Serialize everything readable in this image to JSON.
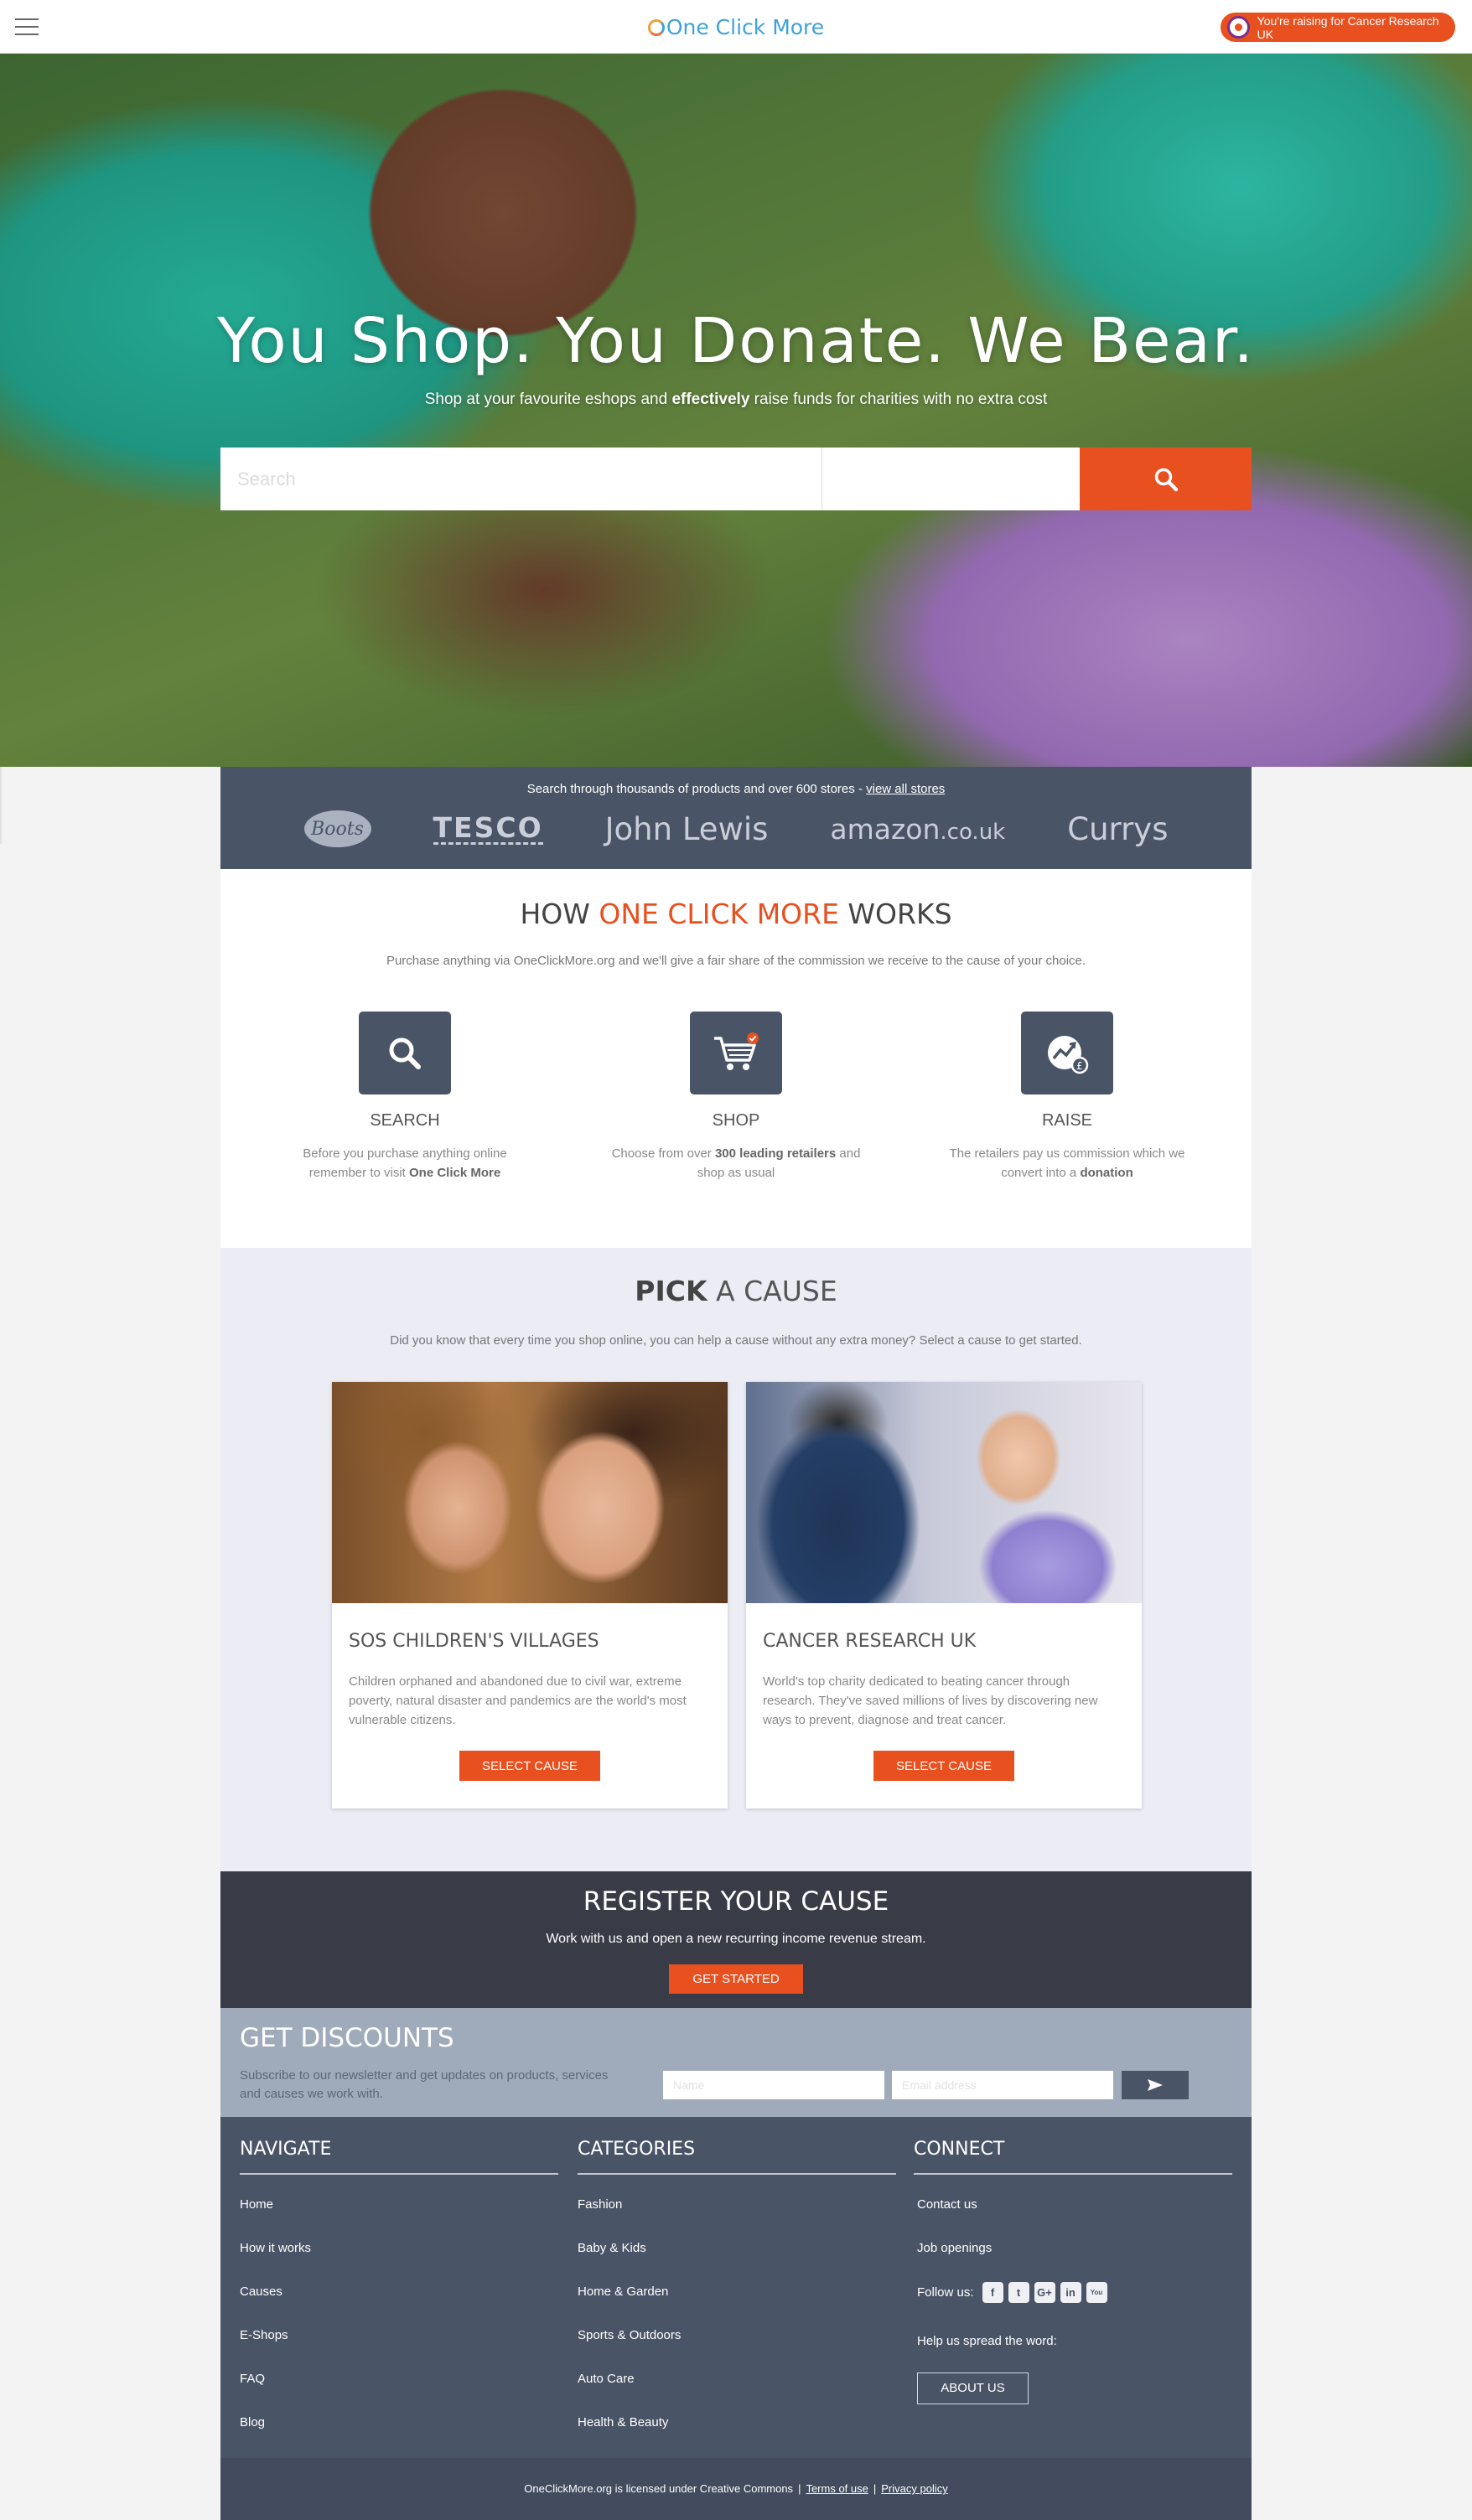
{
  "header": {
    "logo_text": "One Click More",
    "raising_label": "You're raising for Cancer Research UK"
  },
  "hero": {
    "title": "You Shop. You Donate. We Bear.",
    "subtitle_pre": "Shop at your favourite eshops and ",
    "subtitle_bold": "effectively",
    "subtitle_post": " raise funds for charities with no extra cost",
    "search_placeholder": "Search"
  },
  "stores": {
    "text": "Search through thousands of products and over 600 stores - ",
    "link": "view all stores",
    "logos": [
      "Boots",
      "TESCO",
      "John Lewis",
      "amazon",
      ".co.uk",
      "Currys"
    ]
  },
  "how": {
    "title_pre": "HOW ",
    "title_accent": "ONE CLICK MORE",
    "title_post": " WORKS",
    "intro": "Purchase anything via OneClickMore.org and we'll give a fair share of the commission we receive to the cause of your choice.",
    "steps": [
      {
        "title": "SEARCH",
        "desc_pre": "Before you purchase anything online remember to visit ",
        "desc_bold": "One Click More",
        "desc_post": ""
      },
      {
        "title": "SHOP",
        "desc_pre": "Choose from over ",
        "desc_bold": "300 leading retailers",
        "desc_post": " and shop as usual"
      },
      {
        "title": "RAISE",
        "desc_pre": "The retailers pay us commission which we convert into a ",
        "desc_bold": "donation",
        "desc_post": ""
      }
    ]
  },
  "cause": {
    "title_bold": "PICK",
    "title_rest": " A CAUSE",
    "intro": "Did you know that every time you shop online, you can help a cause without any extra money? Select a cause to get started.",
    "cards": [
      {
        "title": "SOS CHILDREN'S VILLAGES",
        "text": "Children orphaned and abandoned due to civil war, extreme poverty, natural disaster and pandemics are the world's most vulnerable citizens.",
        "button": "SELECT CAUSE"
      },
      {
        "title": "CANCER RESEARCH UK",
        "text": "World's top charity dedicated to beating cancer through research. They've saved millions of lives by discovering new ways to prevent, diagnose and treat cancer.",
        "button": "SELECT CAUSE"
      }
    ]
  },
  "register": {
    "title": "REGISTER YOUR CAUSE",
    "text": "Work with us and open a new recurring income revenue stream.",
    "button": "GET STARTED"
  },
  "discounts": {
    "title": "GET DISCOUNTS",
    "text": "Subscribe to our newsletter and get updates on products, services and causes we work with.",
    "name_placeholder": "Name",
    "email_placeholder": "Email address"
  },
  "footer": {
    "navigate": {
      "title": "NAVIGATE",
      "items": [
        "Home",
        "How it works",
        "Causes",
        "E-Shops",
        "FAQ",
        "Blog"
      ]
    },
    "categories": {
      "title": "CATEGORIES",
      "items": [
        "Fashion",
        "Baby & Kids",
        "Home & Garden",
        "Sports & Outdoors",
        "Auto Care",
        "Health & Beauty"
      ]
    },
    "connect": {
      "title": "CONNECT",
      "items": [
        "Contact us",
        "Job openings"
      ],
      "follow_label": "Follow us:",
      "social": [
        "f",
        "t",
        "G+",
        "in",
        "You"
      ],
      "spread_label": "Help us spread the word:",
      "about_button": "ABOUT US"
    }
  },
  "bottom": {
    "license": "OneClickMore.org is licensed under Creative Commons",
    "terms": "Terms of use",
    "privacy": "Privacy policy",
    "separator": "|"
  },
  "colors": {
    "accent": "#e8501f",
    "slate": "#4a5467",
    "dark": "#393b47",
    "discount_bg": "#9fabbb",
    "cause_bg": "#ebecf4"
  },
  "icons": [
    "menu-icon",
    "search-icon",
    "cart-icon",
    "raise-chart-icon",
    "send-icon"
  ]
}
